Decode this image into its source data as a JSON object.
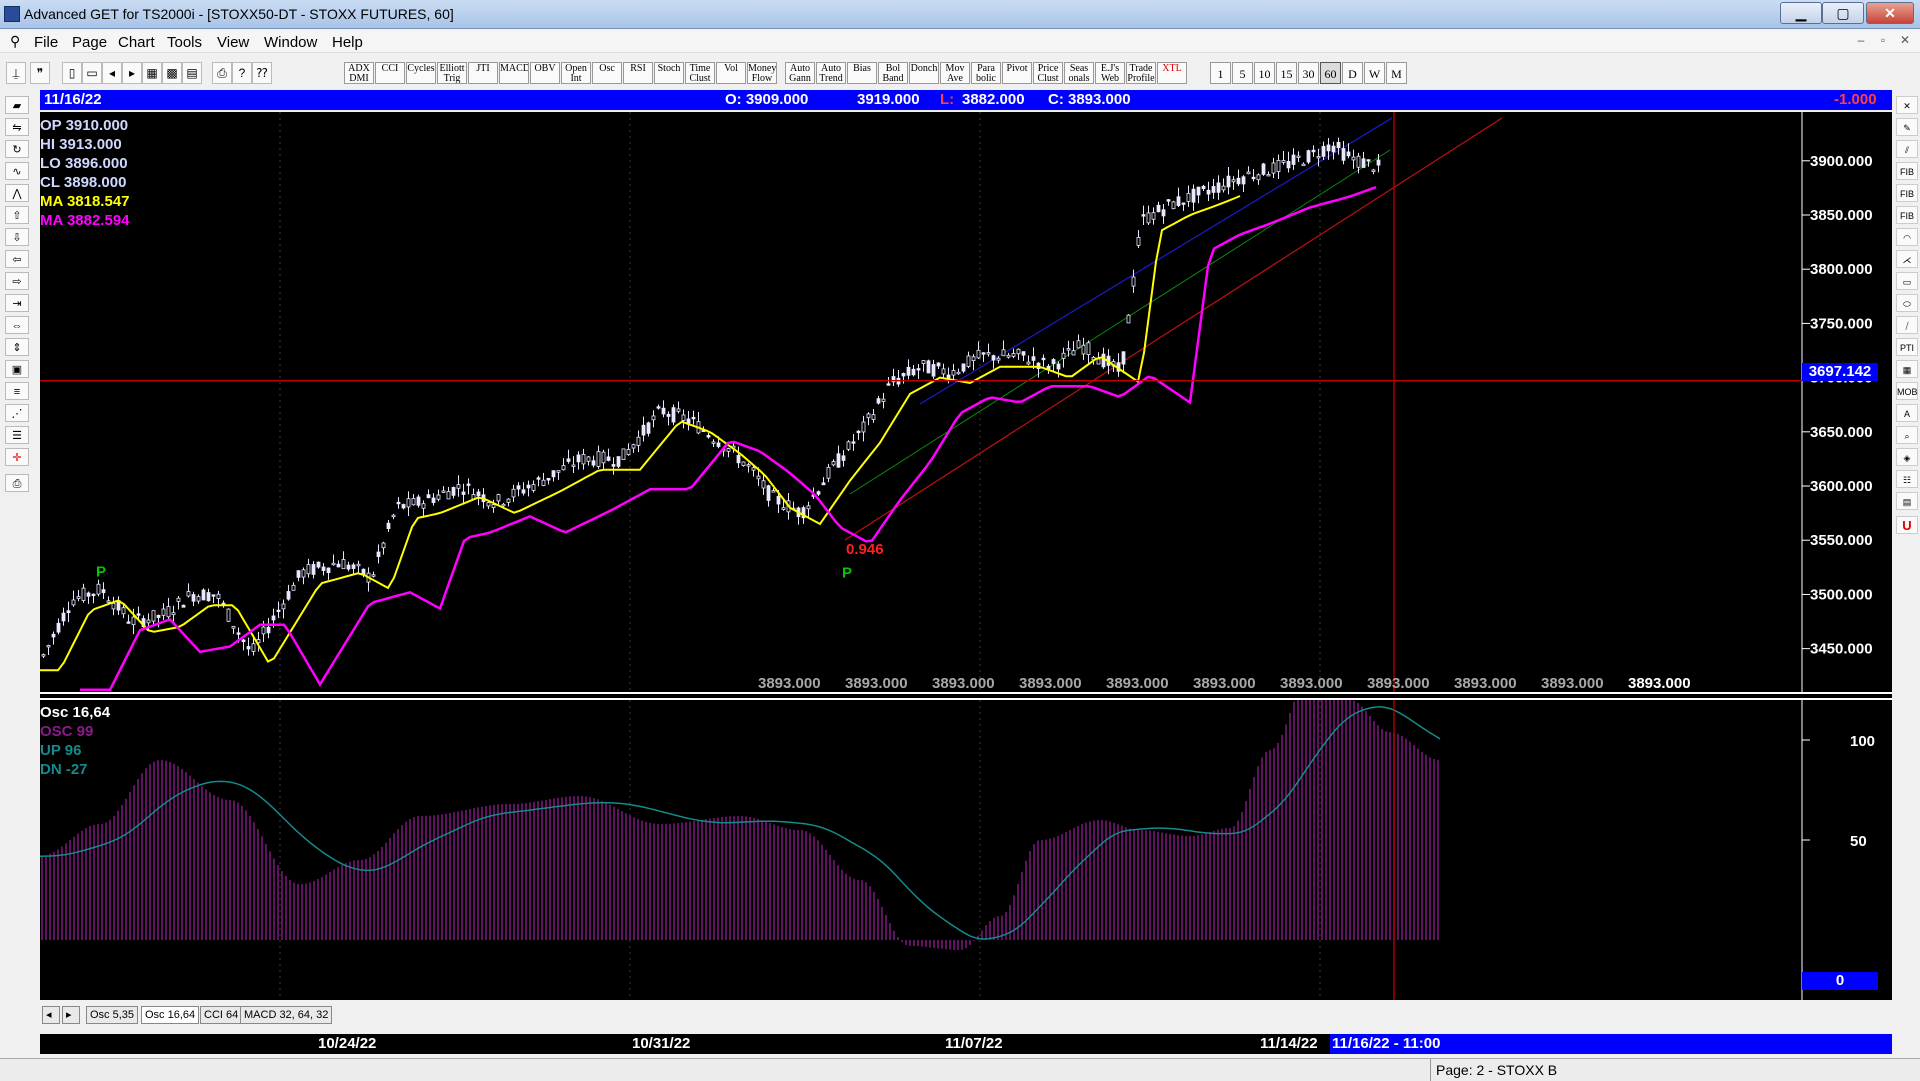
{
  "window": {
    "title": "Advanced GET for TS2000i - [STOXX50-DT - STOXX FUTURES, 60]",
    "minimize": "▁",
    "maximize": "▢",
    "close": "✕",
    "doc_minimize": "–",
    "doc_restore": "▫",
    "doc_close": "✕"
  },
  "menu": [
    "File",
    "Page",
    "Chart",
    "Tools",
    "View",
    "Window",
    "Help"
  ],
  "toolbar": {
    "studies": [
      {
        "label": "ADX DMI"
      },
      {
        "label": "CCI"
      },
      {
        "label": "Cycles"
      },
      {
        "label": "Elliott Trig"
      },
      {
        "label": "JTI"
      },
      {
        "label": "MACD"
      },
      {
        "label": "OBV"
      },
      {
        "label": "Open Int"
      },
      {
        "label": "Osc"
      },
      {
        "label": "RSI"
      },
      {
        "label": "Stoch"
      },
      {
        "label": "Time Clust"
      },
      {
        "label": "Vol"
      },
      {
        "label": "Money Flow"
      },
      {
        "label": "Auto Gann"
      },
      {
        "label": "Auto Trend"
      },
      {
        "label": "Bias"
      },
      {
        "label": "Bol Band"
      },
      {
        "label": "Donch"
      },
      {
        "label": "Mov Ave"
      },
      {
        "label": "Para bolic"
      },
      {
        "label": "Pivot"
      },
      {
        "label": "Price Clust"
      },
      {
        "label": "Seas onals"
      },
      {
        "label": "E.J's Web"
      },
      {
        "label": "Trade Profile"
      },
      {
        "label": "XTL"
      }
    ],
    "intervals": [
      "1",
      "5",
      "10",
      "15",
      "30",
      "60",
      "D",
      "W",
      "M"
    ],
    "selected_interval": "60"
  },
  "info_bar": {
    "date": "11/16/22",
    "open": "O: 3909.000",
    "high": "3919.000",
    "low_label": "L:",
    "low": "3882.000",
    "close": "C: 3893.000",
    "change": "-1.000"
  },
  "data_window": {
    "op": "OP  3910.000",
    "hi": "HI   3913.000",
    "lo": "LO  3896.000",
    "cl": "CL  3898.000",
    "ma1": "MA  3818.547",
    "ma2": "MA  3882.594"
  },
  "price_axis": {
    "ticks": [
      "3900.000",
      "3850.000",
      "3800.000",
      "3750.000",
      "3700.000",
      "3650.000",
      "3600.000",
      "3550.000",
      "3500.000",
      "3450.000"
    ],
    "crosshair_label": "3697.142",
    "bottom_values": [
      "3893.000",
      "3893.000",
      "3893.000",
      "3893.000",
      "3893.000",
      "3893.000",
      "3893.000",
      "3893.000",
      "3893.000",
      "3893.000",
      "3893.000"
    ]
  },
  "annotations": {
    "pivot_label": "P",
    "ratio": "0.946"
  },
  "oscillator": {
    "title": "Osc 16,64",
    "osc": "OSC 99",
    "up": "UP   96",
    "dn": "DN   -27",
    "ticks": [
      "100",
      "50"
    ],
    "zero_label": "0"
  },
  "tabs": [
    "Osc 5,35",
    "Osc 16,64",
    "CCI 64",
    "MACD 32, 64, 32"
  ],
  "time_axis": {
    "labels": [
      "10/24/22",
      "10/31/22",
      "11/07/22",
      "11/14/22"
    ],
    "cursor_label": "11/16/22 - 11:00"
  },
  "status": {
    "page": "Page: 2 - STOXX B"
  },
  "colors": {
    "info_bar": "#0000ff",
    "ma_fast": "#ffff00",
    "ma_slow": "#ff00ff",
    "pivot": "#00c800",
    "crosshair": "#c00000",
    "osc_bars": "#8a1a8a",
    "osc_signal": "#168a8a"
  }
}
